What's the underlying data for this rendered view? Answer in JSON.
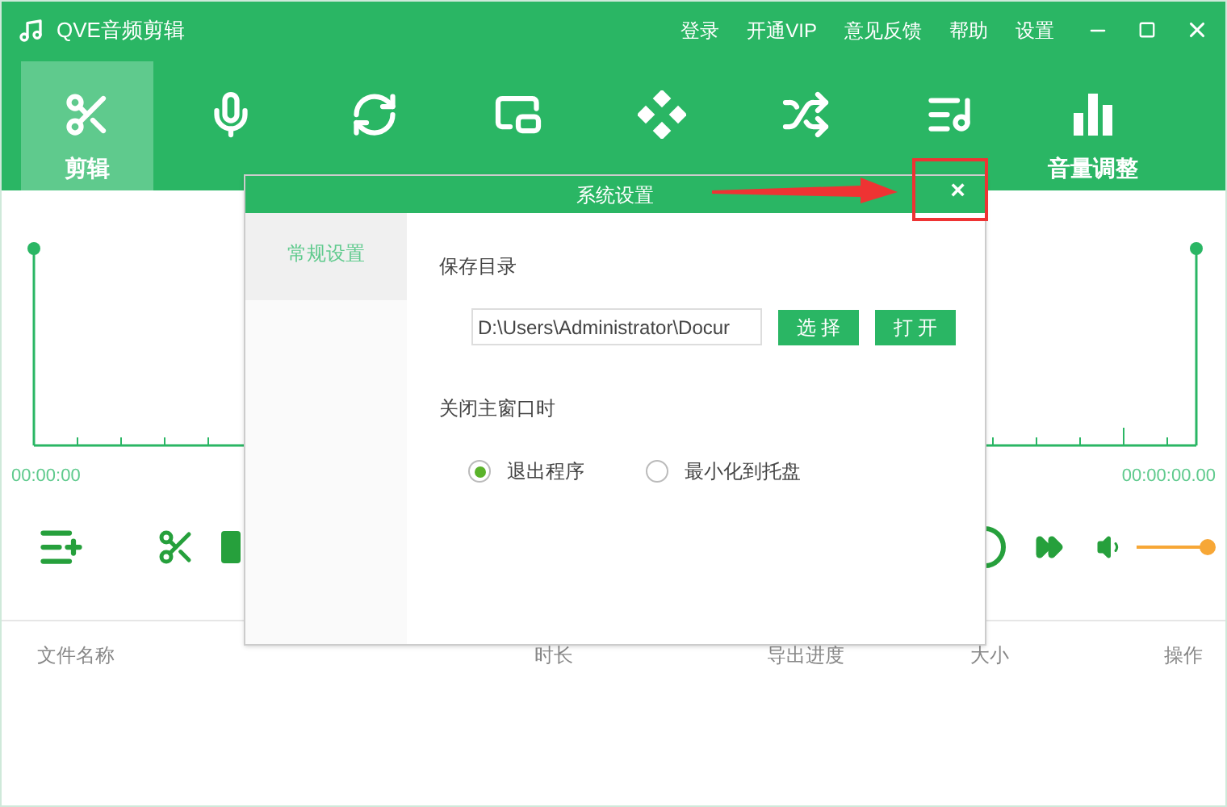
{
  "window": {
    "title": "QVE音频剪辑"
  },
  "menu": [
    "登录",
    "开通VIP",
    "意见反馈",
    "帮助",
    "设置"
  ],
  "tabs": [
    {
      "label": "剪辑",
      "selected": true
    },
    {
      "selected": false
    },
    {
      "selected": false
    },
    {
      "selected": false
    },
    {
      "selected": false
    },
    {
      "selected": false
    },
    {
      "selected": false
    },
    {
      "label": "音量调整",
      "selected": false
    }
  ],
  "timeline": {
    "start": "00:00:00",
    "end": "00:00:00.00"
  },
  "volume": {
    "level": 1
  },
  "table": {
    "columns": [
      "文件名称",
      "时长",
      "导出进度",
      "大小",
      "操作"
    ]
  },
  "dialog": {
    "title": "系统设置",
    "close": "×",
    "sidebar": [
      {
        "label": "常规设置",
        "selected": true
      }
    ],
    "save_dir_label": "保存目录",
    "save_dir": "D:\\Users\\Administrator\\Docur",
    "buttons": [
      "选 择",
      "打 开"
    ],
    "close_label": "关闭主窗口时",
    "options": [
      {
        "label": "退出程序",
        "selected": true
      },
      {
        "label": "最小化到托盘",
        "selected": false
      }
    ]
  }
}
